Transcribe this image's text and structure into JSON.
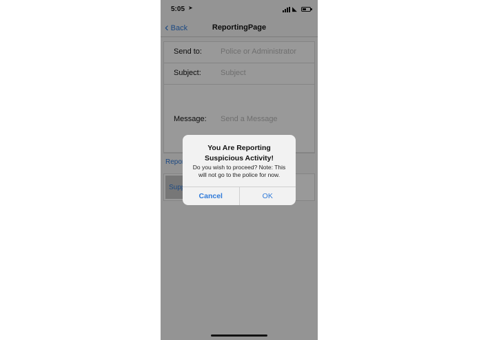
{
  "status_bar": {
    "time": "5:05",
    "location_icon": "location-arrow-icon",
    "signal_icon": "cellular-signal-icon",
    "wifi_icon": "wifi-icon",
    "battery_icon": "battery-icon"
  },
  "nav": {
    "back_label": "Back",
    "title": "ReportingPage"
  },
  "form": {
    "send_to_label": "Send to:",
    "send_to_placeholder": "Police or Administrator",
    "subject_label": "Subject:",
    "subject_placeholder": "Subject",
    "message_label": "Message:",
    "message_placeholder": "Send a Message"
  },
  "report_link": "Repor",
  "submit_label": "Supp",
  "alert": {
    "title": "You Are Reporting Suspicious Activity!",
    "message": "Do you wish to proceed? Note: This will not go to the police for now.",
    "cancel_label": "Cancel",
    "ok_label": "OK"
  },
  "colors": {
    "accent": "#2f7ad9",
    "overlay": "#000000"
  }
}
